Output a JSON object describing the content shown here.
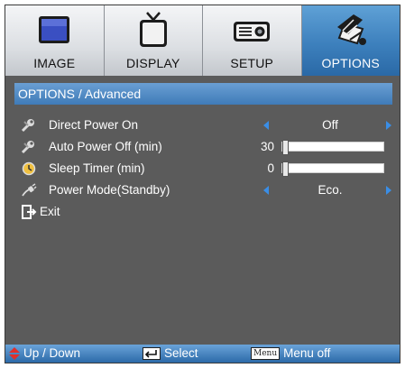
{
  "tabs": [
    {
      "label": "IMAGE",
      "icon": "monitor-icon",
      "active": false
    },
    {
      "label": "DISPLAY",
      "icon": "tv-icon",
      "active": false
    },
    {
      "label": "SETUP",
      "icon": "projector-icon",
      "active": false
    },
    {
      "label": "OPTIONS",
      "icon": "options-icon",
      "active": true
    }
  ],
  "section_title": "OPTIONS / Advanced",
  "menu": {
    "direct_power_on": {
      "label": "Direct Power On",
      "value": "Off"
    },
    "auto_power_off": {
      "label": "Auto Power Off (min)",
      "value": "30",
      "level": 0
    },
    "sleep_timer": {
      "label": "Sleep Timer (min)",
      "value": "0",
      "level": 0
    },
    "power_mode": {
      "label": "Power Mode(Standby)",
      "value": "Eco."
    },
    "exit": {
      "label": "Exit"
    }
  },
  "help": {
    "updown": "Up / Down",
    "select": "Select",
    "menu_key": "Menu",
    "menu_off": "Menu off"
  },
  "colors": {
    "frame": "#5b5b5b",
    "accent": "#3d80bd",
    "arrow": "#3a8ee6"
  }
}
